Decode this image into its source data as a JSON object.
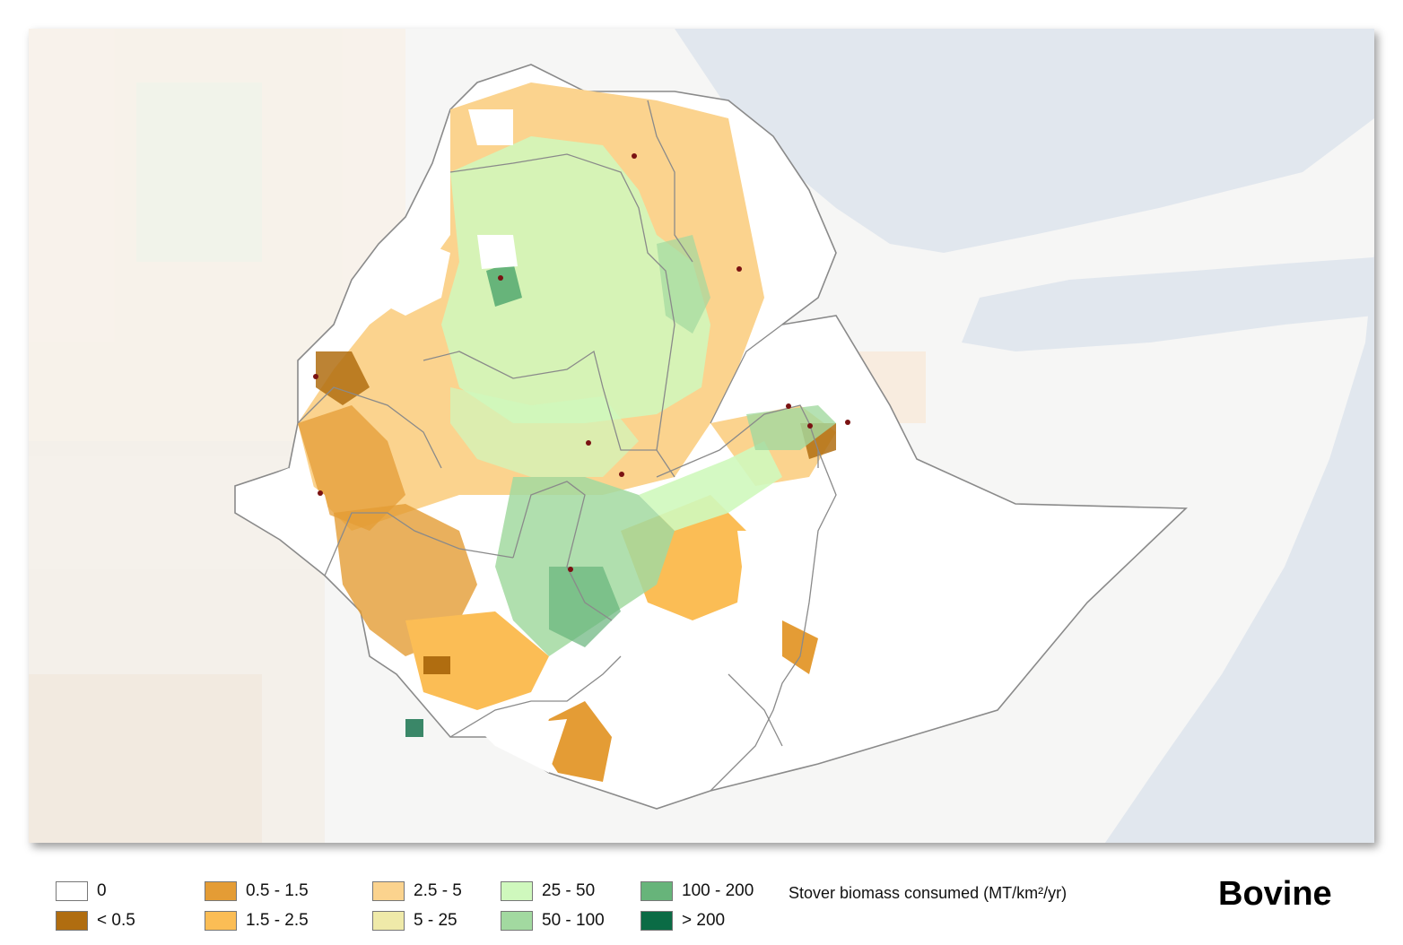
{
  "map": {
    "species_label": "Bovine",
    "legend_title": "Stover biomass consumed (MT/km²/yr)",
    "legend": [
      {
        "label": "0",
        "color": "#ffffff"
      },
      {
        "label": "< 0.5",
        "color": "#b06d10"
      },
      {
        "label": "0.5 - 1.5",
        "color": "#e49c35"
      },
      {
        "label": "1.5 - 2.5",
        "color": "#fbbd55"
      },
      {
        "label": "2.5 - 5",
        "color": "#fbd38e"
      },
      {
        "label": "5 - 25",
        "color": "#efeaa9"
      },
      {
        "label": "25 - 50",
        "color": "#cff8bd"
      },
      {
        "label": "50 - 100",
        "color": "#a2d9a0"
      },
      {
        "label": "100 - 200",
        "color": "#67b47a"
      },
      {
        "label": "> 200",
        "color": "#0b6b45"
      }
    ],
    "colors": {
      "sea": "#e1e7ee",
      "land_background": "#f6f6f5",
      "border": "#8a8a8a",
      "city_marker": "#7a1212"
    }
  }
}
